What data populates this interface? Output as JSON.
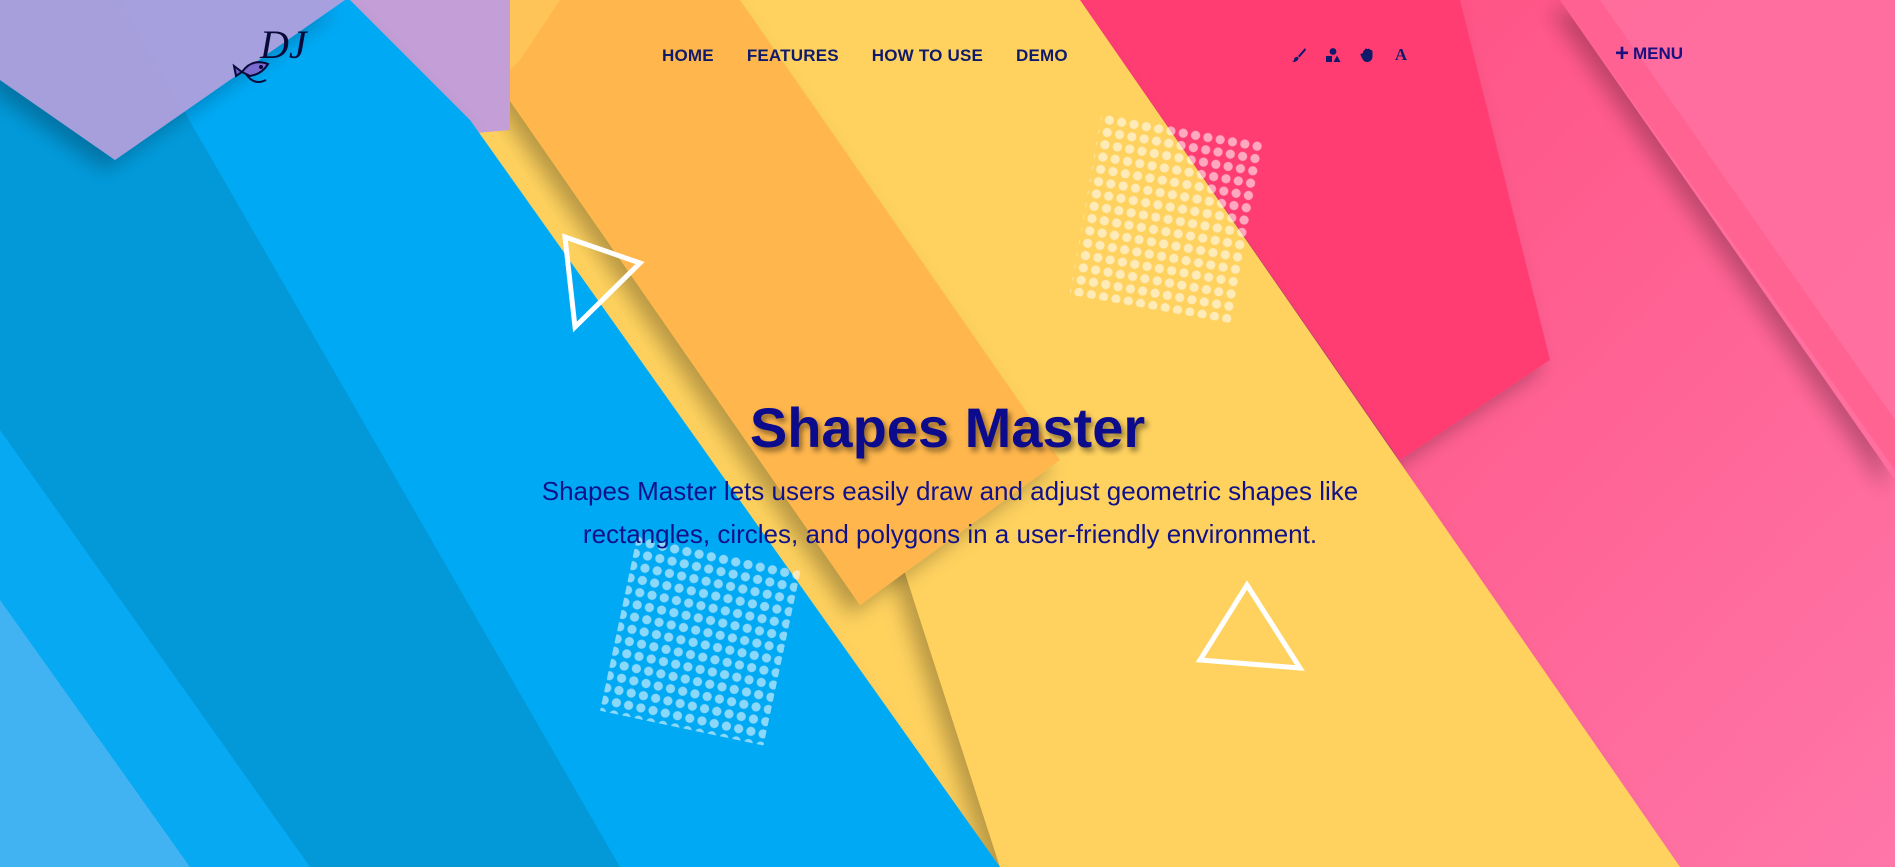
{
  "app": {
    "logo_icon": "fish-logo-icon"
  },
  "nav": {
    "items": [
      {
        "label": "HOME"
      },
      {
        "label": "FEATURES"
      },
      {
        "label": "HOW TO USE"
      },
      {
        "label": "DEMO"
      }
    ]
  },
  "tools": {
    "brush_icon": "paintbrush-icon",
    "shapes_icon": "shapes-icon",
    "hand_icon": "hand-icon",
    "text_label": "A"
  },
  "menu": {
    "label": "MENU",
    "icon": "plus-icon"
  },
  "hero": {
    "title": "Shapes Master",
    "description": "Shapes Master lets users easily draw and adjust geometric shapes like rectangles, circles, and polygons in a user-friendly environment."
  },
  "colors": {
    "blue": "#03a9f4",
    "yellow": "#ffd25e",
    "orange": "#ffb74d",
    "pink": "#ff5c86",
    "hotpink": "#ff3d73",
    "purple": "#c49ed6",
    "navy_text": "#101a6a"
  }
}
